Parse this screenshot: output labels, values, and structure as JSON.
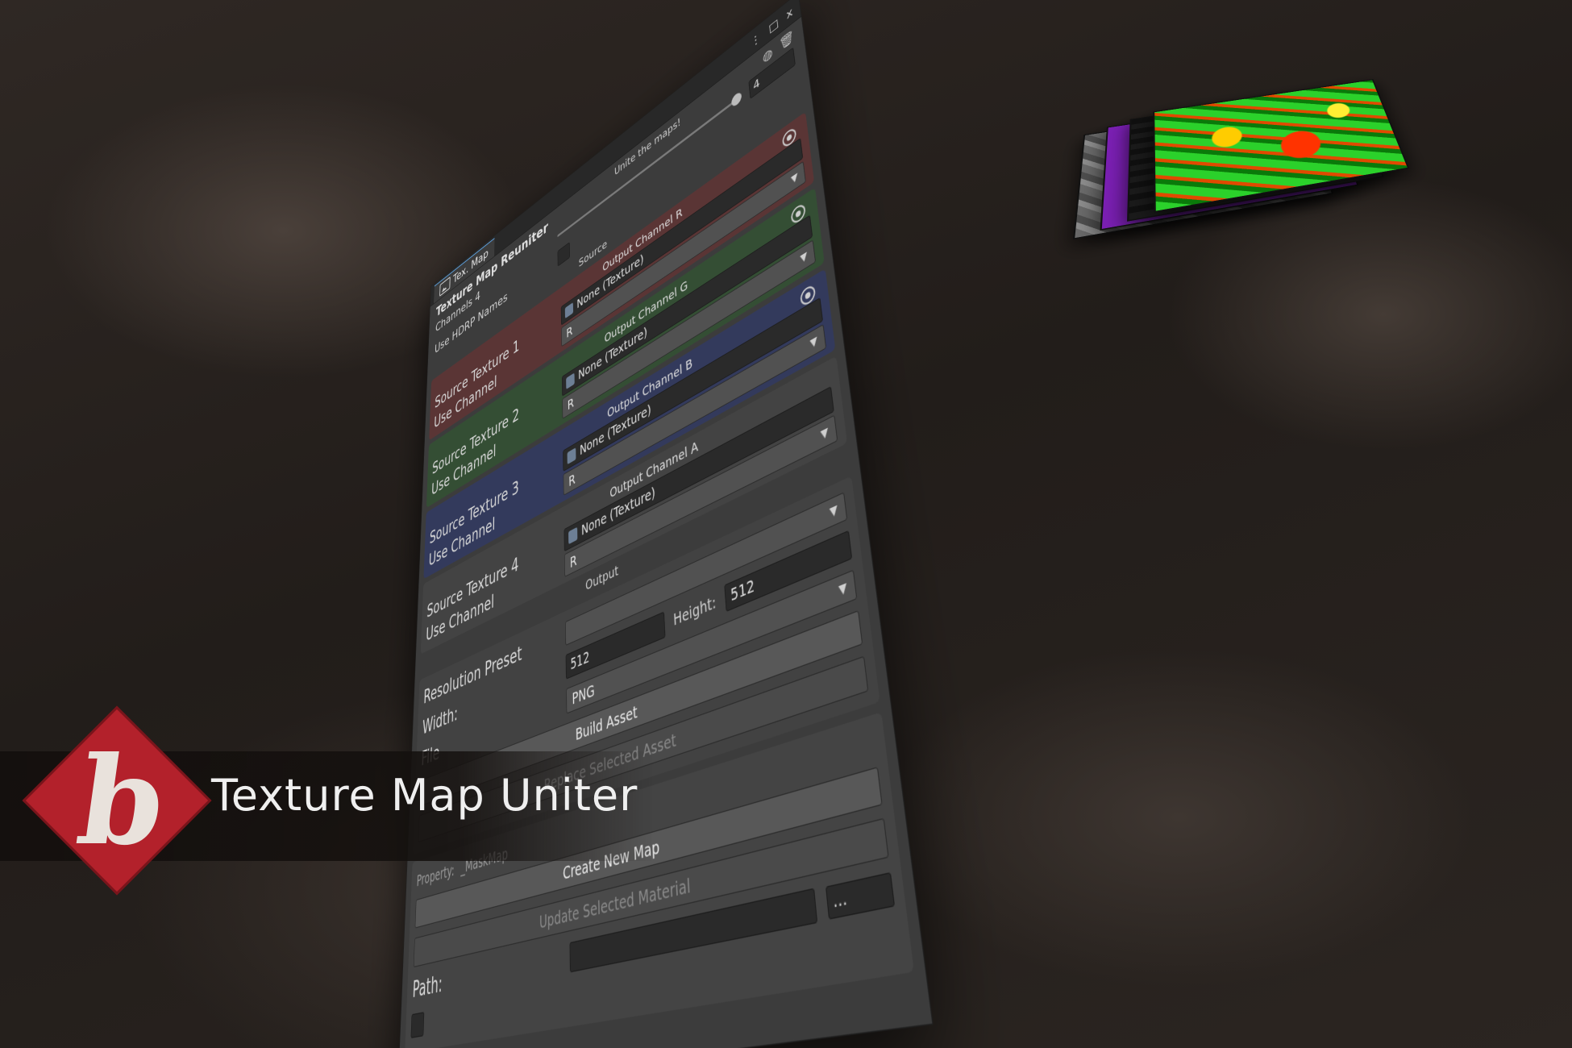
{
  "window": {
    "tab_title": "Tex. Map",
    "controls": {
      "menu": "⋮",
      "maximize": "□",
      "close": "x"
    }
  },
  "header": {
    "title": "Texture Map Reuniter",
    "unite_label": "Unite the maps!",
    "channels_label": "Channels 4",
    "channels_value": "4",
    "hdrp_label": "Use HDRP Names",
    "source_section": "Source"
  },
  "sources": [
    {
      "label": "Source Texture 1",
      "use_channel": "Use Channel",
      "output_channel": "Output Channel R",
      "texture": "None (Texture)",
      "channel": "R",
      "color": "#5a3535"
    },
    {
      "label": "Source Texture 2",
      "use_channel": "Use Channel",
      "output_channel": "Output Channel G",
      "texture": "None (Texture)",
      "channel": "R",
      "color": "#344e34"
    },
    {
      "label": "Source Texture 3",
      "use_channel": "Use Channel",
      "output_channel": "Output Channel B",
      "texture": "None (Texture)",
      "channel": "R",
      "color": "#333a5c"
    },
    {
      "label": "Source Texture 4",
      "use_channel": "Use Channel",
      "output_channel": "Output Channel A",
      "texture": "None (Texture)",
      "channel": "R",
      "color": "#434343"
    }
  ],
  "output": {
    "section_label": "Output",
    "resolution_label": "Resolution Preset",
    "width_label": "Width:",
    "width_value": "512",
    "height_label": "Height:",
    "height_value": "512",
    "file_label": "File",
    "file_value": "PNG",
    "build_button": "Build Asset",
    "replace_button": "Replace Selected Asset",
    "property_label": "Property:",
    "property_value": "_MaskMap",
    "create_button": "Create New Map",
    "update_button": "Update Selected Material",
    "path_label": "Path:",
    "path_browse": "..."
  },
  "brand": {
    "title": "Texture Map Uniter",
    "logo_glyph": "b",
    "logo_color": "#b3212b"
  }
}
